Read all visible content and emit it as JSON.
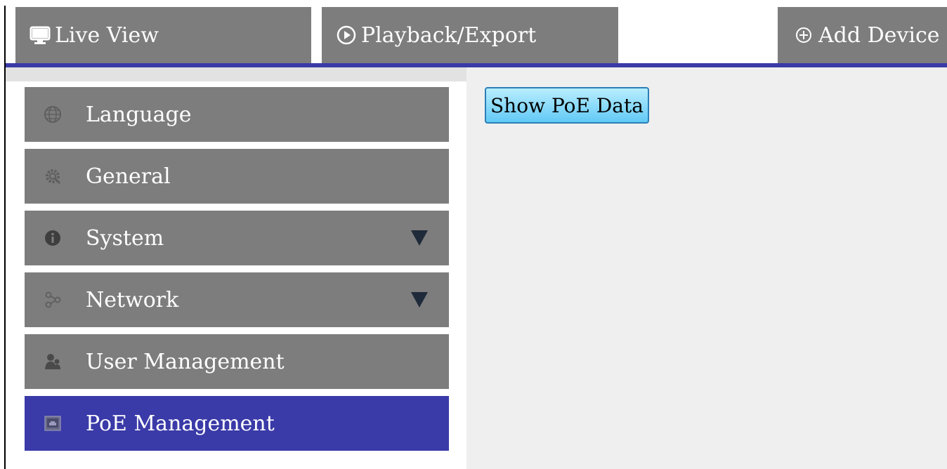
{
  "tabs": {
    "live_view": "Live View",
    "playback": "Playback/Export",
    "add_device": "Add Device"
  },
  "sidebar": {
    "items": [
      {
        "label": "Language",
        "icon": "globe-icon"
      },
      {
        "label": "General",
        "icon": "gear-icon"
      },
      {
        "label": "System",
        "icon": "info-icon",
        "expandable": true
      },
      {
        "label": "Network",
        "icon": "network-icon",
        "expandable": true
      },
      {
        "label": "User Management",
        "icon": "user-icon"
      },
      {
        "label": "PoE Management",
        "icon": "poe-icon",
        "active": true
      }
    ]
  },
  "content": {
    "show_poe_button": "Show PoE Data"
  },
  "colors": {
    "tab_bg": "#7d7d7d",
    "accent": "#3a3aa8",
    "button": "#62c9f5"
  }
}
